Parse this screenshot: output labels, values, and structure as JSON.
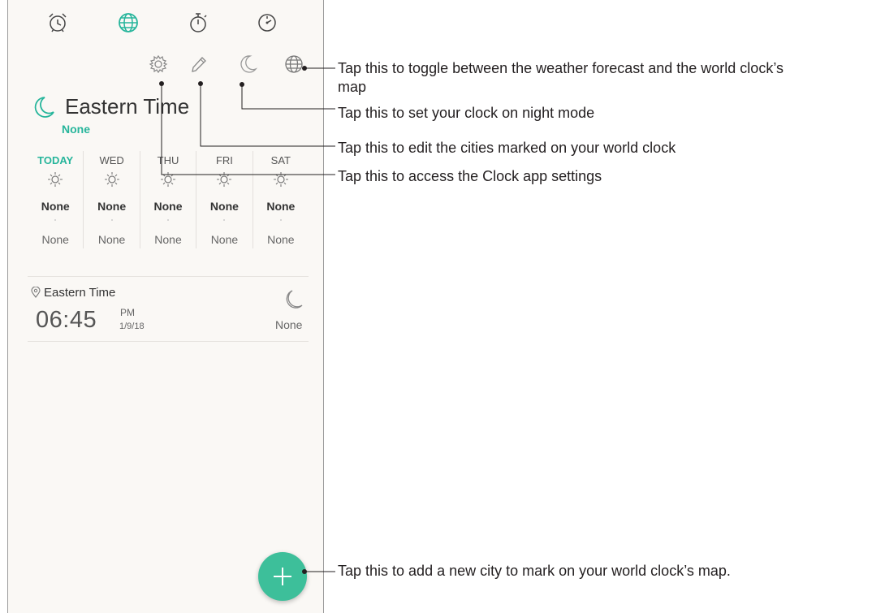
{
  "forecast": [
    {
      "day": "TODAY",
      "high": "None",
      "low": "None"
    },
    {
      "day": "WED",
      "high": "None",
      "low": "None"
    },
    {
      "day": "THU",
      "high": "None",
      "low": "None"
    },
    {
      "day": "FRI",
      "high": "None",
      "low": "None"
    },
    {
      "day": "SAT",
      "high": "None",
      "low": "None"
    }
  ],
  "header": {
    "city": "Eastern Time",
    "status": "None"
  },
  "world_clock_row": {
    "city": "Eastern Time",
    "time": "06:45",
    "ampm": "PM",
    "date": "1/9/18",
    "weather": "None"
  },
  "callouts": {
    "map_toggle_line1": "Tap this to toggle between the weather forecast and the world clock’s",
    "map_toggle_line2": "map",
    "night_mode": "Tap this to set your clock on night mode",
    "edit_cities": "Tap this to edit the cities marked on your world clock",
    "settings": "Tap this to access the Clock app settings",
    "add_city": "Tap this to add a new city to mark on your world clock’s map."
  },
  "colors": {
    "accent": "#26b59b",
    "fab": "#3dbf9a",
    "background": "#faf8f5"
  },
  "icons": {
    "tabs": [
      "alarm-icon",
      "world-clock-icon",
      "stopwatch-icon",
      "timer-icon"
    ],
    "toolbar": [
      "settings-icon",
      "edit-icon",
      "night-mode-icon",
      "globe-icon"
    ]
  }
}
